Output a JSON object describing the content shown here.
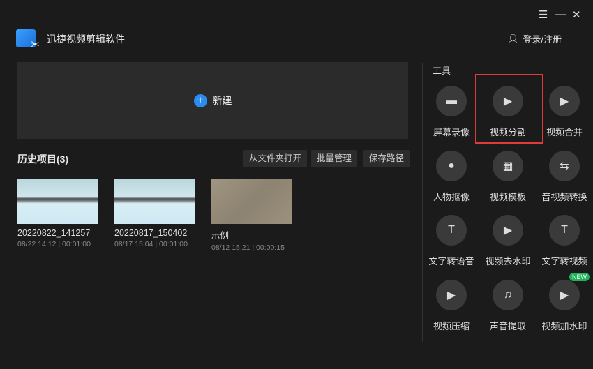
{
  "window": {
    "menu_icon": "☰",
    "minimize_icon": "—",
    "close_icon": "✕"
  },
  "header": {
    "title": "迅捷视频剪辑软件",
    "login": "登录/注册"
  },
  "new_project": {
    "label": "新建"
  },
  "history": {
    "title": "历史项目(3)",
    "buttons": [
      "从文件夹打开",
      "批量管理",
      "保存路径"
    ],
    "items": [
      {
        "name": "20220822_141257",
        "meta": "08/22 14:12 | 00:01:00"
      },
      {
        "name": "20220817_150402",
        "meta": "08/17 15:04 | 00:01:00"
      },
      {
        "name": "示例",
        "meta": "08/12 15:21 | 00:00:15"
      }
    ]
  },
  "tools": {
    "title": "工具",
    "badge": "NEW",
    "items": [
      {
        "label": "屏幕录像",
        "icon": "▬"
      },
      {
        "label": "视频分割",
        "icon": "▶"
      },
      {
        "label": "视频合并",
        "icon": "▶"
      },
      {
        "label": "人物抠像",
        "icon": "●"
      },
      {
        "label": "视频模板",
        "icon": "▦"
      },
      {
        "label": "音视频转换",
        "icon": "⇆"
      },
      {
        "label": "文字转语音",
        "icon": "T"
      },
      {
        "label": "视频去水印",
        "icon": "▶"
      },
      {
        "label": "文字转视频",
        "icon": "T"
      },
      {
        "label": "视频压缩",
        "icon": "▶"
      },
      {
        "label": "声音提取",
        "icon": "♫"
      },
      {
        "label": "视频加水印",
        "icon": "▶"
      }
    ]
  }
}
